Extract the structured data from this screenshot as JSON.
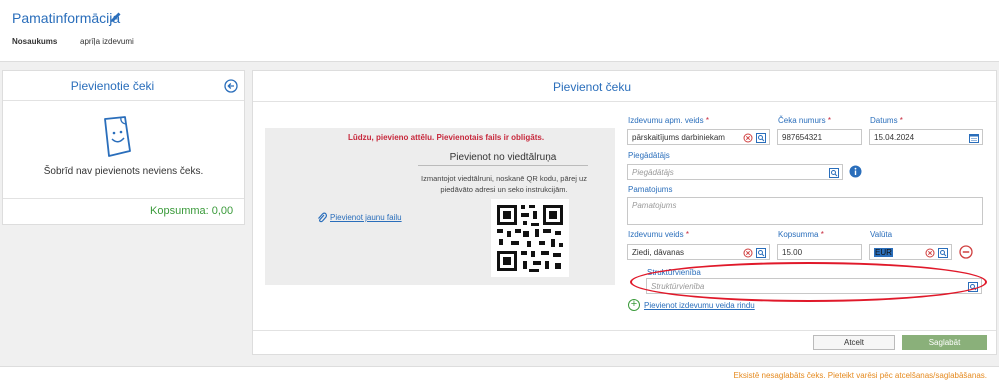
{
  "header": {
    "title": "Pamatinformācija",
    "meta_label": "Nosaukums",
    "meta_value": "aprīļa izdevumi"
  },
  "left_panel": {
    "title": "Pievienotie čeki",
    "empty_text": "Šobrīd nav pievienots neviens čeks.",
    "total": "Kopsumma: 0,00"
  },
  "right_panel": {
    "title": "Pievienot čeku",
    "upload": {
      "error": "Lūdzu, pievieno attēlu. Pievienotais fails ir obligāts.",
      "add_file": "Pievienot jaunu failu",
      "qr_title": "Pievienot no viedtālruņa",
      "qr_instructions": "Izmantojot viedtālruni, noskanē QR kodu, pārej uz piedāvāto adresi un seko instrukcijām."
    },
    "fields": {
      "expense_type": {
        "label": "Izdevumu apm. veids",
        "value": "pārskaitījums darbiniekam"
      },
      "receipt_number": {
        "label": "Čeka numurs",
        "value": "987654321"
      },
      "date": {
        "label": "Datums",
        "value": "15.04.2024"
      },
      "supplier": {
        "label": "Piegādātājs",
        "placeholder": "Piegādātājs"
      },
      "justification": {
        "label": "Pamatojums",
        "placeholder": "Pamatojums"
      },
      "expense_kind": {
        "label": "Izdevumu veids",
        "value": "Ziedi, dāvanas"
      },
      "amount": {
        "label": "Kopsumma",
        "value": "15.00"
      },
      "currency": {
        "label": "Valūta",
        "value": "EUR"
      },
      "structural_unit": {
        "label": "Struktūrvienība",
        "placeholder": "Struktūrvienība"
      }
    },
    "required_mark": "*",
    "add_row": "Pievienot izdevumu veida rindu",
    "cancel": "Atcelt",
    "save": "Saglabāt"
  },
  "footer": {
    "message": "Eksistē nesaglabāts čeks. Pieteikt varēsi pēc atcelšanas/saglabāšanas."
  },
  "colors": {
    "accent": "#2a6ebb",
    "error": "#c7283c",
    "success": "#3a9a3a",
    "warning": "#e58a1f",
    "highlight_oval": "#e0192a"
  }
}
